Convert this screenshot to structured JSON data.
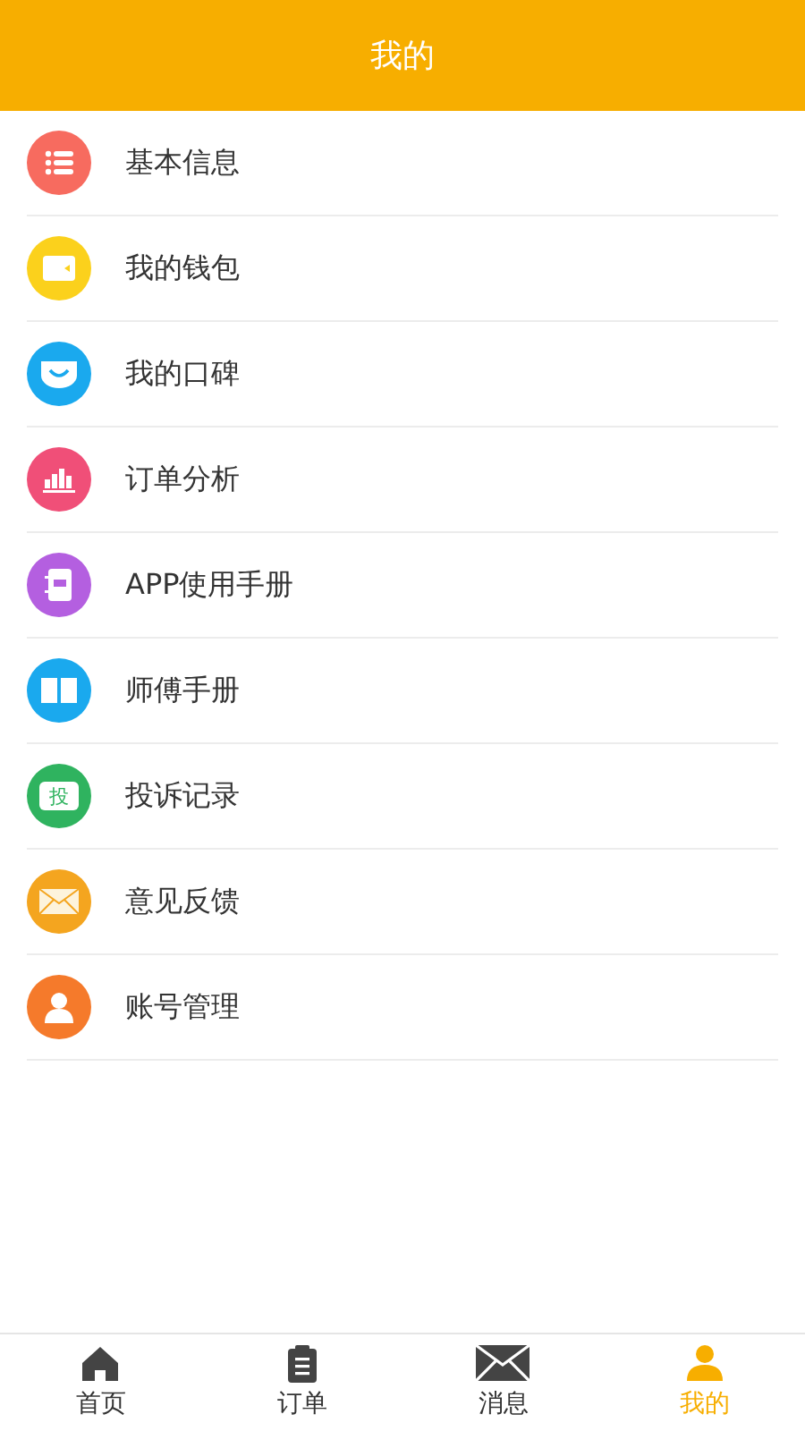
{
  "header": {
    "title": "我的"
  },
  "menu_items": [
    {
      "label": "基本信息",
      "kind": "list",
      "color": "#f76b5f"
    },
    {
      "label": "我的钱包",
      "kind": "wallet",
      "color": "#fbd11c"
    },
    {
      "label": "我的口碑",
      "kind": "smile",
      "color": "#1aa9ee"
    },
    {
      "label": "订单分析",
      "kind": "chart",
      "color": "#f04f78"
    },
    {
      "label": "APP使用手册",
      "kind": "notebook",
      "color": "#b45fe0"
    },
    {
      "label": "师傅手册",
      "kind": "book",
      "color": "#1aa9ee"
    },
    {
      "label": "投诉记录",
      "kind": "complaint",
      "color": "#2fb35f",
      "badge": "投"
    },
    {
      "label": "意见反馈",
      "kind": "mail",
      "color": "#f4a51f"
    },
    {
      "label": "账号管理",
      "kind": "person",
      "color": "#f57a2b"
    }
  ],
  "tab_bar": [
    {
      "label": "首页",
      "kind": "home",
      "selected": false
    },
    {
      "label": "订单",
      "kind": "clipboard",
      "selected": false
    },
    {
      "label": "消息",
      "kind": "mail",
      "selected": false
    },
    {
      "label": "我的",
      "kind": "person",
      "selected": true
    }
  ]
}
